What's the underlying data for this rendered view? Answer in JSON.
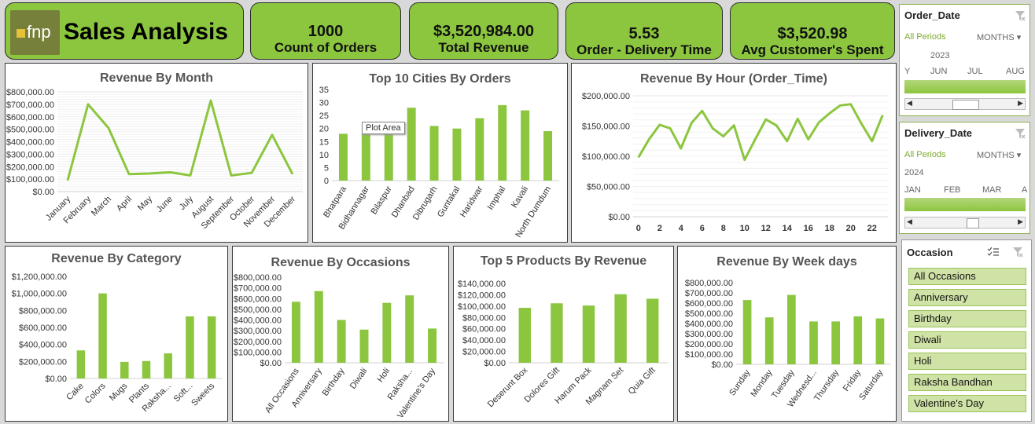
{
  "header": {
    "logo_text": "fnp",
    "title": "Sales Analysis"
  },
  "kpis": [
    {
      "value": "1000",
      "label": "Count of Orders"
    },
    {
      "value": "$3,520,984.00",
      "label": "Total Revenue"
    },
    {
      "value": "5.53",
      "label": "Order - Delivery Time"
    },
    {
      "value": "$3,520.98",
      "label": "Avg Customer's Spent"
    }
  ],
  "tooltip": "Plot Area",
  "colors": {
    "accent": "#8cc63f",
    "bar": "#8cc63f",
    "line": "#8cc63f"
  },
  "slicers": {
    "order_date": {
      "title": "Order_Date",
      "periods": "All Periods",
      "unit": "MONTHS",
      "year": "2023",
      "months": [
        "Y",
        "JUN",
        "JUL",
        "AUG"
      ]
    },
    "delivery_date": {
      "title": "Delivery_Date",
      "periods": "All Periods",
      "unit": "MONTHS",
      "year": "2024",
      "months": [
        "JAN",
        "FEB",
        "MAR",
        "A"
      ]
    },
    "occasion": {
      "title": "Occasion",
      "items": [
        "All Occasions",
        "Anniversary",
        "Birthday",
        "Diwali",
        "Holi",
        "Raksha Bandhan",
        "Valentine's Day"
      ]
    }
  },
  "chart_data": [
    {
      "id": "month",
      "type": "line",
      "title": "Revenue By Month",
      "categories": [
        "January",
        "February",
        "March",
        "April",
        "May",
        "June",
        "July",
        "August",
        "September",
        "October",
        "November",
        "December"
      ],
      "values": [
        90000,
        700000,
        510000,
        140000,
        145000,
        155000,
        130000,
        730000,
        130000,
        150000,
        455000,
        140000
      ],
      "yticks": [
        "$800,000.00",
        "$700,000.00",
        "$600,000.00",
        "$500,000.00",
        "$400,000.00",
        "$300,000.00",
        "$200,000.00",
        "$100,000.00",
        "$0.00"
      ],
      "ylim": [
        0,
        800000
      ]
    },
    {
      "id": "cities",
      "type": "bar",
      "title": "Top 10 Cities By Orders",
      "categories": [
        "Bhatpara",
        "Bidhannagar",
        "Bilaspur",
        "Dhanbad",
        "Dibrugarh",
        "Guntakal",
        "Haridwar",
        "Imphal",
        "Kavali",
        "North Dumdum"
      ],
      "values": [
        18,
        18,
        18,
        28,
        21,
        20,
        24,
        29,
        27,
        19
      ],
      "yticks": [
        "35",
        "30",
        "25",
        "20",
        "15",
        "10",
        "5",
        "0"
      ],
      "ylim": [
        0,
        35
      ]
    },
    {
      "id": "hour",
      "type": "line",
      "title": "Revenue By Hour (Order_Time)",
      "categories": [
        "0",
        "1",
        "2",
        "3",
        "4",
        "5",
        "6",
        "7",
        "8",
        "9",
        "10",
        "11",
        "12",
        "13",
        "14",
        "15",
        "16",
        "17",
        "18",
        "19",
        "20",
        "21",
        "22",
        "23"
      ],
      "xticks": [
        "0",
        "2",
        "4",
        "6",
        "8",
        "10",
        "12",
        "14",
        "16",
        "18",
        "20",
        "22"
      ],
      "values": [
        98000,
        128000,
        152000,
        146000,
        113000,
        155000,
        175000,
        146000,
        133000,
        151000,
        94000,
        128000,
        161000,
        151000,
        125000,
        162000,
        128000,
        156000,
        171000,
        184000,
        186000,
        154000,
        125000,
        168000
      ],
      "yticks": [
        "$200,000.00",
        "$150,000.00",
        "$100,000.00",
        "$50,000.00",
        "$0.00"
      ],
      "ylim": [
        0,
        200000
      ]
    },
    {
      "id": "category",
      "type": "bar",
      "title": "Revenue By Category",
      "categories": [
        "Cake",
        "Colors",
        "Mugs",
        "Plants",
        "Raksha...",
        "Soft...",
        "Sweets"
      ],
      "values": [
        330000,
        1000000,
        195000,
        205000,
        295000,
        730000,
        730000
      ],
      "yticks": [
        "$1,200,000.00",
        "$1,000,000.00",
        "$800,000.00",
        "$600,000.00",
        "$400,000.00",
        "$200,000.00",
        "$0.00"
      ],
      "ylim": [
        0,
        1200000
      ]
    },
    {
      "id": "occasions",
      "type": "bar",
      "title": "Revenue By Occasions",
      "categories": [
        "All Occasions",
        "Anniversary",
        "Birthday",
        "Diwali",
        "Holi",
        "Raksha...",
        "Valentine's Day"
      ],
      "values": [
        570000,
        670000,
        400000,
        310000,
        560000,
        630000,
        320000
      ],
      "yticks": [
        "$800,000.00",
        "$700,000.00",
        "$600,000.00",
        "$500,000.00",
        "$400,000.00",
        "$300,000.00",
        "$200,000.00",
        "$100,000.00",
        "$0.00"
      ],
      "ylim": [
        0,
        800000
      ]
    },
    {
      "id": "products",
      "type": "bar",
      "title": "Top 5 Products By Revenue",
      "categories": [
        "Deserunt Box",
        "Dolores Gift",
        "Harum Pack",
        "Magnam Set",
        "Quia Gift"
      ],
      "values": [
        97000,
        105000,
        101000,
        121000,
        113000
      ],
      "yticks": [
        "$140,000.00",
        "$120,000.00",
        "$100,000.00",
        "$80,000.00",
        "$60,000.00",
        "$40,000.00",
        "$20,000.00",
        "$0.00"
      ],
      "ylim": [
        0,
        140000
      ]
    },
    {
      "id": "weekdays",
      "type": "bar",
      "title": "Revenue By Week days",
      "categories": [
        "Sunday",
        "Monday",
        "Tuesday",
        "Wednesd...",
        "Thursday",
        "Friday",
        "Saturday"
      ],
      "values": [
        630000,
        460000,
        680000,
        420000,
        420000,
        470000,
        450000
      ],
      "yticks": [
        "$800,000.00",
        "$700,000.00",
        "$600,000.00",
        "$500,000.00",
        "$400,000.00",
        "$300,000.00",
        "$200,000.00",
        "$100,000.00",
        "$0.00"
      ],
      "ylim": [
        0,
        800000
      ]
    }
  ]
}
